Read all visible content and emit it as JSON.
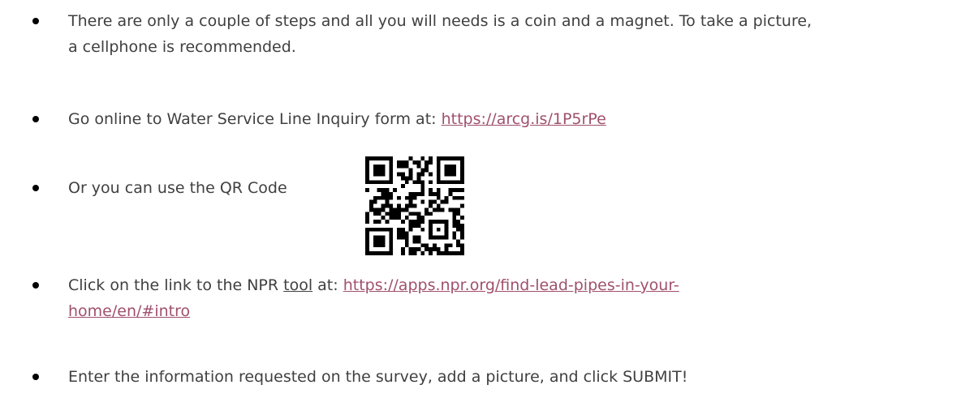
{
  "bullets": {
    "b1": {
      "line1": "There are only a couple of steps and all you will needs is a coin and a magnet. To take a picture,",
      "line2": "a cellphone is recommended."
    },
    "b2": {
      "prefix": "Go online to Water Service Line Inquiry form at: ",
      "link": "https://arcg.is/1P5rPe"
    },
    "b3": {
      "text": "Or you can use the QR Code"
    },
    "b4": {
      "prefix": "Click on the link to the NPR ",
      "underlined": "tool",
      "middle": " at: ",
      "link_line1": "https://apps.npr.org/find-lead-pipes-in-your-",
      "link_line2": "home/en/#intro"
    },
    "b5": {
      "text": "Enter the information requested on the survey, add a picture, and click SUBMIT!"
    }
  },
  "colors": {
    "body_text": "#404040",
    "link": "#a0506d",
    "bullet": "#000000"
  }
}
